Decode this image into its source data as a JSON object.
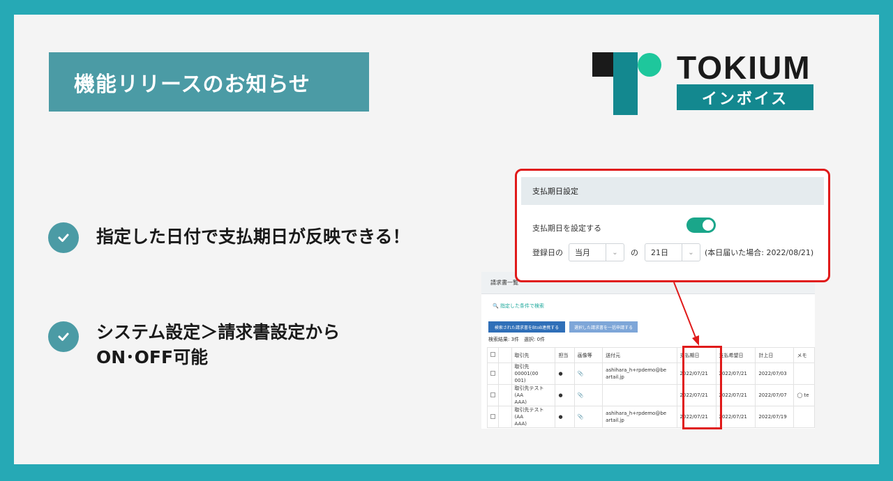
{
  "header": {
    "badge_text": "機能リリースのお知らせ"
  },
  "logo": {
    "word": "TOKIUM",
    "sub": "インボイス"
  },
  "features": [
    {
      "line1": "指定した日付で支払期日が反映できる！",
      "line2": ""
    },
    {
      "line1": "システム設定＞請求書設定から",
      "line2": "ON･OFF可能"
    }
  ],
  "popup": {
    "title": "支払期日設定",
    "toggle_label": "支払期日を設定する",
    "toggle_on": true,
    "prefix": "登録日の",
    "month_select": "当月",
    "particle": "の",
    "day_select": "21日",
    "note": "(本日届いた場合: 2022/08/21)"
  },
  "screenshot": {
    "title": "請求書一覧",
    "search_link": "指定した条件で検索",
    "button_a": "検索された請求書をBtoB連携する",
    "button_b": "選択した請求書を一括申請する",
    "count_text": "検索結果: 3件　選択: 0件",
    "columns": [
      "取引先",
      "担当",
      "画像等",
      "送付元",
      "支払期日",
      "支払希望日",
      "計上日",
      "メモ"
    ],
    "rows": [
      {
        "partner": "取引先00001(00\n001)",
        "sender": "ashihara_h+rpdemo@be\nartail.jp",
        "due": "2022/07/21",
        "wish": "2022/07/21",
        "book": "2022/07/03",
        "memo": ""
      },
      {
        "partner": "取引先テスト(AA\nAAA)",
        "sender": "",
        "due": "2022/07/21",
        "wish": "2022/07/21",
        "book": "2022/07/07",
        "memo": "te"
      },
      {
        "partner": "取引先テスト(AA\nAAA)",
        "sender": "ashihara_h+rpdemo@be\nartail.jp",
        "due": "2022/07/21",
        "wish": "2022/07/21",
        "book": "2022/07/19",
        "memo": ""
      }
    ]
  },
  "colors": {
    "frame": "#26a9b5",
    "accent": "#4b9ba5",
    "highlight": "#e01a1a",
    "toggle": "#1aa68a"
  }
}
